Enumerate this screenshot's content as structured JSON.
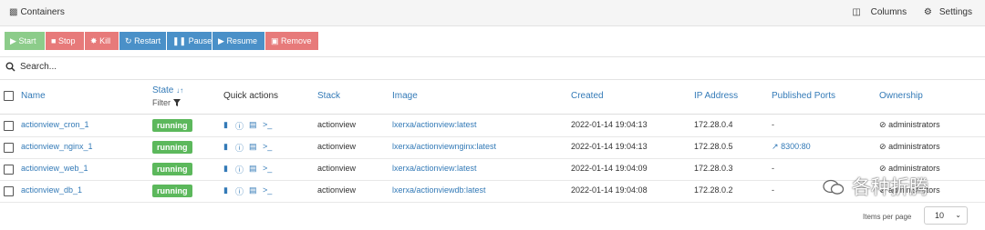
{
  "header": {
    "title": "Containers",
    "columns_label": "Columns",
    "settings_label": "Settings"
  },
  "toolbar": {
    "buttons": [
      {
        "label": "Start",
        "icon": "play-icon",
        "color": "#8ccc8a"
      },
      {
        "label": "Stop",
        "icon": "stop-icon",
        "color": "#e77a7a"
      },
      {
        "label": "Kill",
        "icon": "bomb-icon",
        "color": "#e77a7a"
      },
      {
        "label": "Restart",
        "icon": "sync-icon",
        "color": "#4a90c8"
      },
      {
        "label": "Pause",
        "icon": "pause-icon",
        "color": "#4a90c8"
      },
      {
        "label": "Resume",
        "icon": "play-icon",
        "color": "#4a90c8"
      },
      {
        "label": "Remove",
        "icon": "trash-icon",
        "color": "#e77a7a"
      }
    ]
  },
  "search": {
    "placeholder": "Search..."
  },
  "table": {
    "headers": {
      "name": "Name",
      "state": "State",
      "state_filter": "Filter",
      "quick_actions": "Quick actions",
      "stack": "Stack",
      "image": "Image",
      "created": "Created",
      "ip": "IP Address",
      "ports": "Published Ports",
      "ownership": "Ownership"
    },
    "rows": [
      {
        "name": "actionview_cron_1",
        "state": "running",
        "stack": "actionview",
        "image": "lxerxa/actionview:latest",
        "created": "2022-01-14 19:04:13",
        "ip": "172.28.0.4",
        "ports": "-",
        "ownership": "administrators"
      },
      {
        "name": "actionview_nginx_1",
        "state": "running",
        "stack": "actionview",
        "image": "lxerxa/actionviewnginx:latest",
        "created": "2022-01-14 19:04:13",
        "ip": "172.28.0.5",
        "ports": "8300:80",
        "ownership": "administrators"
      },
      {
        "name": "actionview_web_1",
        "state": "running",
        "stack": "actionview",
        "image": "lxerxa/actionview:latest",
        "created": "2022-01-14 19:04:09",
        "ip": "172.28.0.3",
        "ports": "-",
        "ownership": "administrators"
      },
      {
        "name": "actionview_db_1",
        "state": "running",
        "stack": "actionview",
        "image": "lxerxa/actionviewdb:latest",
        "created": "2022-01-14 19:04:08",
        "ip": "172.28.0.2",
        "ports": "-",
        "ownership": "administrators"
      }
    ]
  },
  "footer": {
    "items_per_page_label": "Items per page",
    "items_per_page_value": "10"
  },
  "watermark": {
    "text": "各种折腾"
  },
  "colors": {
    "link": "#337ab7",
    "running": "#5cb85c"
  }
}
